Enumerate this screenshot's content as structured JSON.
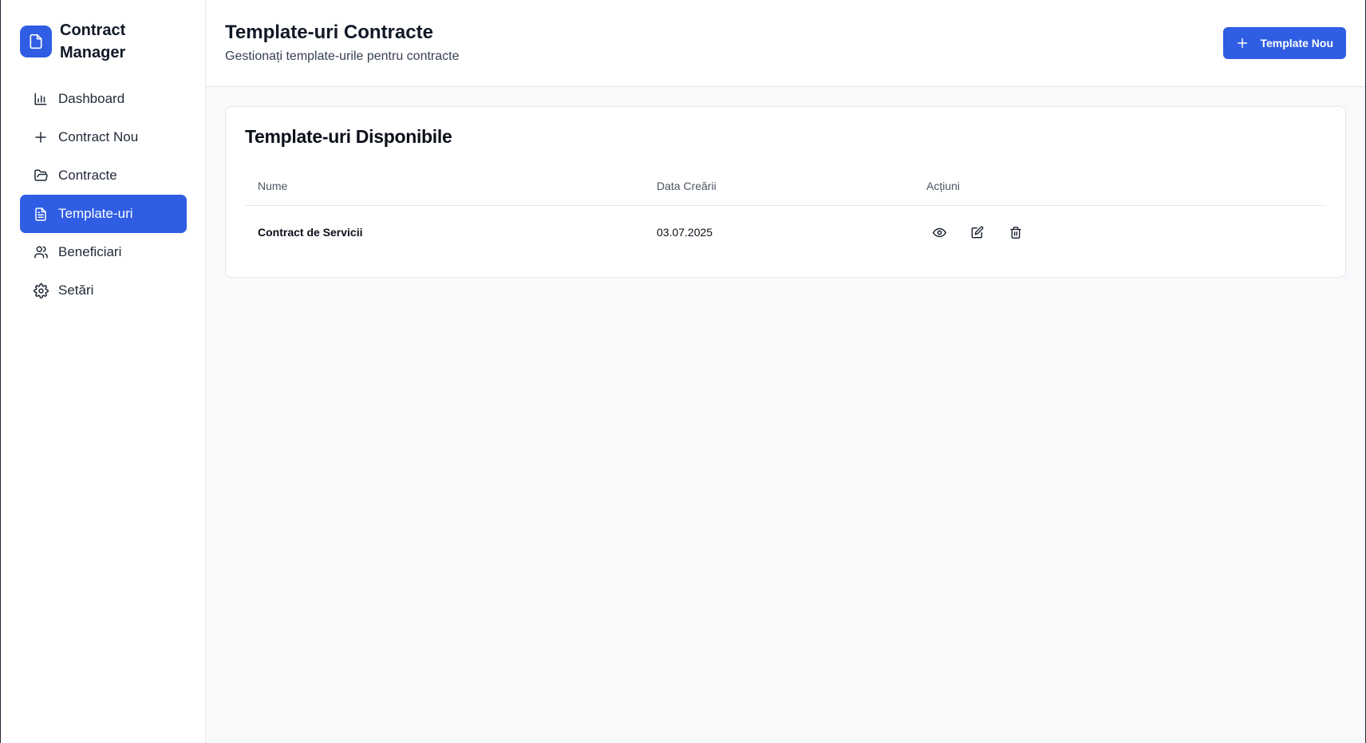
{
  "brand": {
    "line1": "Contract",
    "line2": "Manager",
    "logo_icon": "file-icon",
    "color": "#2f5de4"
  },
  "sidebar": {
    "items": [
      {
        "label": "Dashboard",
        "icon": "bar-chart-icon",
        "active": false
      },
      {
        "label": "Contract Nou",
        "icon": "plus-icon",
        "active": false
      },
      {
        "label": "Contracte",
        "icon": "folder-open-icon",
        "active": false
      },
      {
        "label": "Template-uri",
        "icon": "file-text-icon",
        "active": true
      },
      {
        "label": "Beneficiari",
        "icon": "users-icon",
        "active": false
      },
      {
        "label": "Setări",
        "icon": "gear-icon",
        "active": false
      }
    ]
  },
  "header": {
    "title": "Template-uri Contracte",
    "subtitle": "Gestionați template-urile pentru contracte",
    "new_button_label": "Template Nou"
  },
  "card": {
    "title": "Template-uri Disponibile",
    "columns": [
      "Nume",
      "Data Creării",
      "Acțiuni"
    ],
    "rows": [
      {
        "name": "Contract de Servicii",
        "date": "03.07.2025",
        "actions": [
          "eye-icon",
          "edit-icon",
          "trash-icon"
        ]
      }
    ]
  },
  "colors": {
    "accent": "#2f5de4",
    "background": "#f8f9fb",
    "border": "#e5e7eb"
  }
}
